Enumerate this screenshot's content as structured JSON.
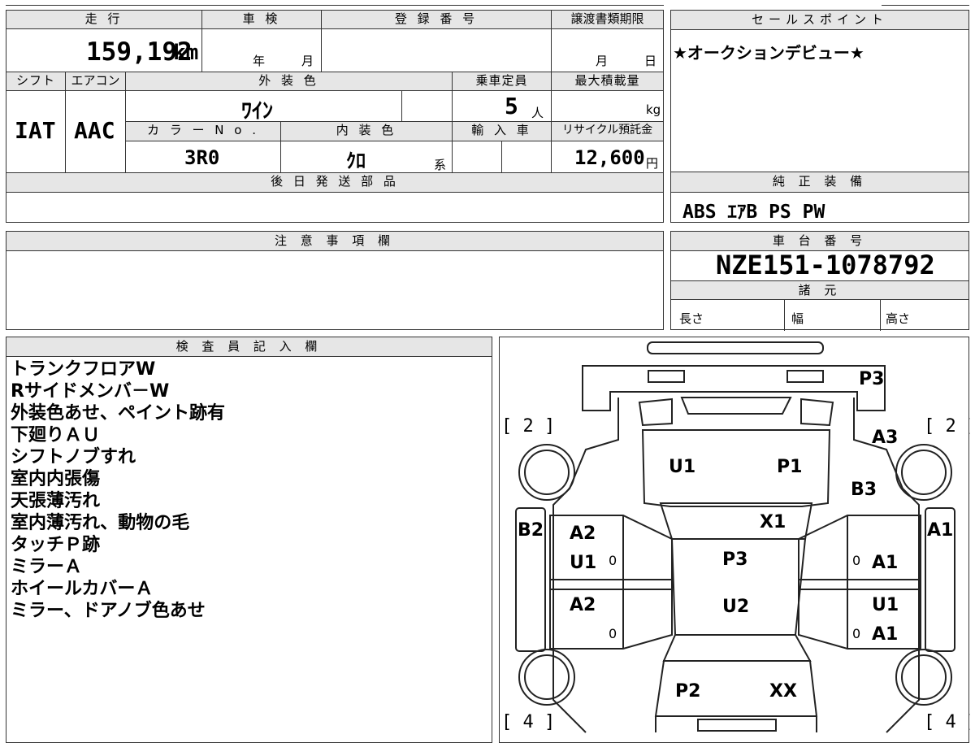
{
  "top": {
    "mileage_label": "走 行",
    "mileage_value": "159,192",
    "mileage_unit": "km",
    "shaken_label": "車 検",
    "shaken_year": "年",
    "shaken_month": "月",
    "reg_label": "登 録 番 号",
    "transfer_label": "譲渡書類期限",
    "transfer_month": "月",
    "transfer_day": "日",
    "shift_label": "シフト",
    "shift_value": "IAT",
    "ac_label": "エアコン",
    "ac_value": "AAC",
    "exterior_label": "外 装 色",
    "exterior_value": "ﾜｲﾝ",
    "capacity_label": "乗車定員",
    "capacity_value": "5",
    "capacity_unit": "人",
    "maxload_label": "最大積載量",
    "maxload_unit": "kg",
    "color_no_label": "カ ラ ー N o .",
    "color_no_value": "3R0",
    "interior_label": "内 装 色",
    "interior_value": "ｸﾛ",
    "interior_suffix": "系",
    "import_label": "輸 入 車",
    "recycle_label": "リサイクル預託金",
    "recycle_value": "12,600",
    "recycle_unit": "円",
    "later_parts_label": "後 日 発 送 部 品"
  },
  "sales": {
    "label": "セールスポイント",
    "text": "★オークションデビュー★"
  },
  "equipment": {
    "label": "純 正 装 備",
    "text": "ABS ｴｱB PS PW"
  },
  "notes": {
    "label": "注 意 事 項 欄"
  },
  "chassis": {
    "label": "車 台 番 号",
    "value": "NZE151-1078792",
    "spec_label": "諸 元",
    "length_label": "長さ",
    "width_label": "幅",
    "height_label": "高さ"
  },
  "inspector": {
    "label": "検 査 員 記 入 欄",
    "lines": [
      "トランクフロアW",
      "Rサイドメンバ－W",
      "外装色あせ、ペイント跡有",
      "下廻りＡＵ",
      "シフトノブすれ",
      "室内内張傷",
      "天張薄汚れ",
      "室内薄汚れ、動物の毛",
      "タッチＰ跡",
      "ミラーＡ",
      "ホイールカバーＡ",
      "ミラー、ドアノブ色あせ"
    ]
  },
  "diagram": {
    "marks": {
      "rear_bumper": "P3",
      "tire_rear_left": "[ 2 ]",
      "tire_rear_right": "[ 2 ]",
      "tire_front_left": "[ 4 ]",
      "tire_front_right": "[ 4 ]",
      "trunk_left": "U1",
      "trunk_right": "P1",
      "rear_quarter_right_a": "A3",
      "rear_quarter_right_b": "B3",
      "roof_top": "X1",
      "roof": "P3",
      "roof_low": "U2",
      "left_side": "B2",
      "right_side": "A1",
      "rear_door_left_1": "A2",
      "rear_door_left_2": "U1",
      "rear_door_left_zero": "0",
      "rear_door_right_zero": "0",
      "rear_door_right": "A1",
      "front_door_left": "A2",
      "front_door_left_zero": "0",
      "front_door_right_1": "U1",
      "front_door_right_zero": "0",
      "front_door_right_2": "A1",
      "hood_left": "P2",
      "hood_right": "XX"
    }
  }
}
